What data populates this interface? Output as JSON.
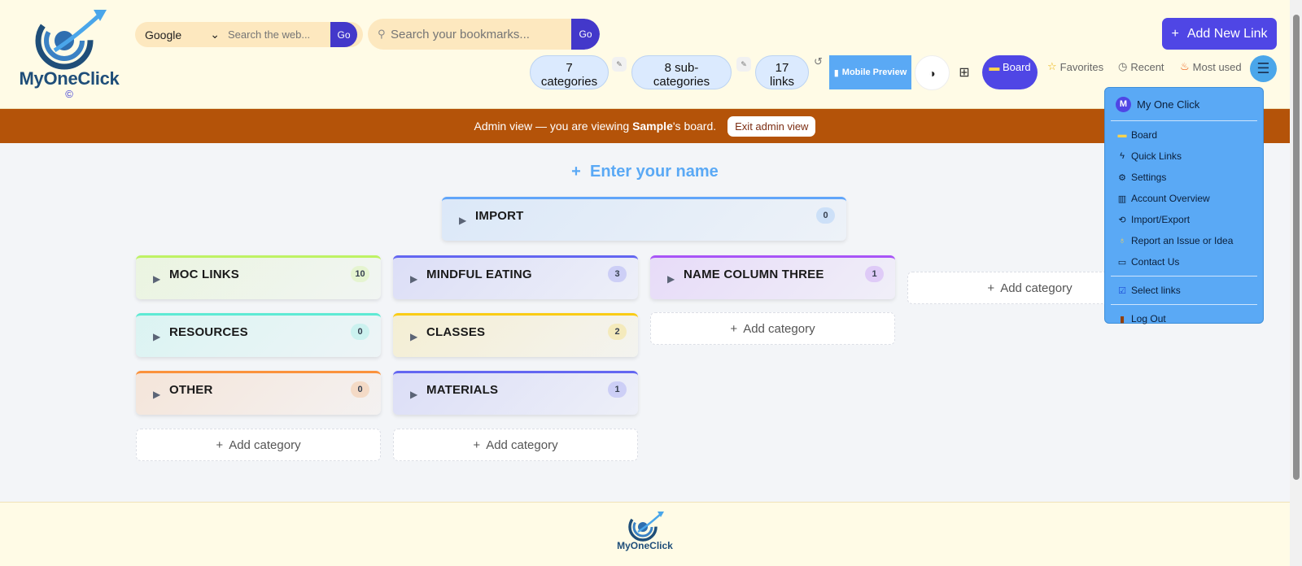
{
  "header": {
    "logo_text": "MyOneClick",
    "logo_copyright": "©",
    "web_search": {
      "engine": "Google",
      "placeholder": "Search the web...",
      "go_label": "Go"
    },
    "bookmark_search": {
      "placeholder": "Search your bookmarks...",
      "go_label": "Go"
    },
    "stats": {
      "categories": "7 categories",
      "sub_categories": "8 sub-categories",
      "links": "17 links"
    },
    "mobile_preview_label": "Mobile Preview",
    "board_label": "Board",
    "nav": {
      "favorites": "Favorites",
      "recent": "Recent",
      "most_used": "Most used"
    },
    "add_new_link_label": "Add New Link"
  },
  "admin_banner": {
    "prefix": "Admin view — you are viewing ",
    "user": "Sample",
    "suffix": "'s board.",
    "exit_label": "Exit admin view"
  },
  "main": {
    "enter_name": "Enter your name",
    "add_category_label": "Add category",
    "categories": [
      {
        "title": "IMPORT",
        "count": "0",
        "accent": "#60a5fa"
      },
      {
        "title": "MOC LINKS",
        "count": "10",
        "accent": "#bef264"
      },
      {
        "title": "MINDFUL EATING",
        "count": "3",
        "accent": "#6366f1"
      },
      {
        "title": "NAME COLUMN THREE",
        "count": "1",
        "accent": "#a855f7"
      },
      {
        "title": "RESOURCES",
        "count": "0",
        "accent": "#5eead4"
      },
      {
        "title": "CLASSES",
        "count": "2",
        "accent": "#facc15"
      },
      {
        "title": "OTHER",
        "count": "0",
        "accent": "#fb923c"
      },
      {
        "title": "MATERIALS",
        "count": "1",
        "accent": "#6366f1"
      }
    ]
  },
  "menu": {
    "user_initial": "M",
    "user_name": "My One Click",
    "items": [
      "Board",
      "Quick Links",
      "Settings",
      "Account Overview",
      "Import/Export",
      "Report an Issue or Idea",
      "Contact Us"
    ],
    "select_links": "Select links",
    "log_out": "Log Out"
  },
  "footer": {
    "logo_text": "MyOneClick"
  }
}
